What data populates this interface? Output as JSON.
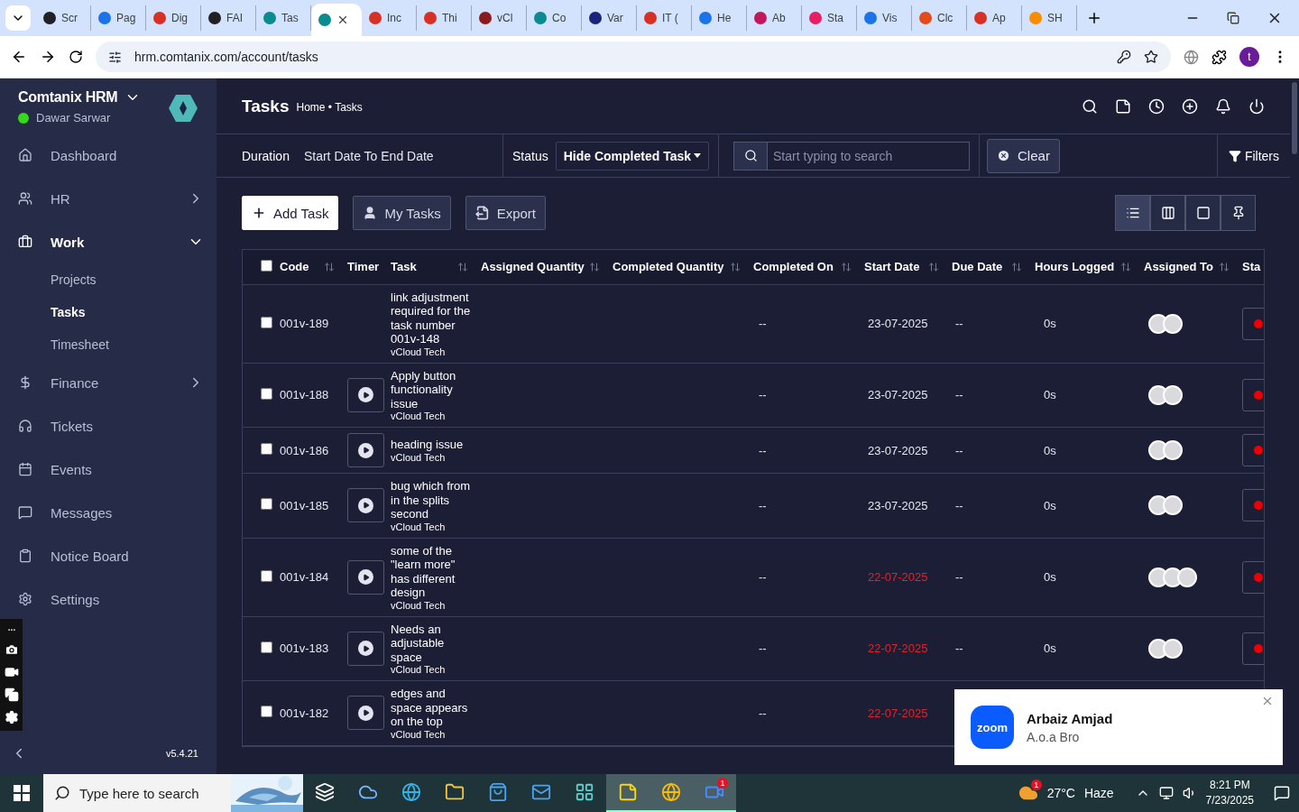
{
  "browser": {
    "tabs": [
      {
        "label": "Scr",
        "selected": false
      },
      {
        "label": "Pag",
        "selected": false
      },
      {
        "label": "Dig",
        "selected": false
      },
      {
        "label": "FAI",
        "selected": false
      },
      {
        "label": "Tas",
        "selected": false
      },
      {
        "selected": true
      },
      {
        "label": "Inc",
        "selected": false
      },
      {
        "label": "Thi",
        "selected": false
      },
      {
        "label": "vCl",
        "selected": false
      },
      {
        "label": "Co",
        "selected": false
      },
      {
        "label": "Var",
        "selected": false
      },
      {
        "label": "IT (",
        "selected": false
      },
      {
        "label": "He",
        "selected": false
      },
      {
        "label": "Ab",
        "selected": false
      },
      {
        "label": "Sta",
        "selected": false
      },
      {
        "label": "Vis",
        "selected": false
      },
      {
        "label": "Clc",
        "selected": false
      },
      {
        "label": "Ap",
        "selected": false
      },
      {
        "label": "SH",
        "selected": false
      }
    ],
    "url": "hrm.comtanix.com/account/tasks",
    "profile_initial": "t"
  },
  "sidebar": {
    "brand": "Comtanix HRM",
    "user": "Dawar Sarwar",
    "online": true,
    "items": [
      {
        "label": "Dashboard",
        "selected": false
      },
      {
        "label": "HR",
        "selected": false,
        "expanded": false
      },
      {
        "label": "Work",
        "selected": true,
        "expanded": true,
        "children": [
          {
            "label": "Projects",
            "selected": false
          },
          {
            "label": "Tasks",
            "selected": true
          },
          {
            "label": "Timesheet",
            "selected": false
          }
        ]
      },
      {
        "label": "Finance",
        "selected": false,
        "expanded": false
      },
      {
        "label": "Tickets",
        "selected": false
      },
      {
        "label": "Events",
        "selected": false
      },
      {
        "label": "Messages",
        "selected": false
      },
      {
        "label": "Notice Board",
        "selected": false
      },
      {
        "label": "Settings",
        "selected": false
      }
    ],
    "version": "v5.4.21"
  },
  "header": {
    "title": "Tasks",
    "breadcrumb": "Home • Tasks"
  },
  "filters": {
    "duration_label": "Duration",
    "duration_value": "Start Date To End Date",
    "status_label": "Status",
    "status_value": "Hide Completed Task",
    "search_placeholder": "Start typing to search",
    "clear": "Clear",
    "filters": "Filters"
  },
  "actions": [
    {
      "label": "Add Task",
      "kind": "primary"
    },
    {
      "label": "My Tasks",
      "kind": "secondary"
    },
    {
      "label": "Export",
      "kind": "secondary"
    }
  ],
  "views": [
    {
      "selected": true
    },
    {
      "selected": false
    },
    {
      "selected": false
    },
    {
      "selected": false
    }
  ],
  "table": {
    "all_checked": false,
    "columns": [
      {
        "label": "Code",
        "sortable": true
      },
      {
        "label": "Timer",
        "sortable": false
      },
      {
        "label": "Task",
        "sortable": true
      },
      {
        "label": "Assigned Quantity",
        "sortable": true
      },
      {
        "label": "Completed Quantity",
        "sortable": true
      },
      {
        "label": "Completed On",
        "sortable": true
      },
      {
        "label": "Start Date",
        "sortable": true
      },
      {
        "label": "Due Date",
        "sortable": true
      },
      {
        "label": "Hours Logged",
        "sortable": true
      },
      {
        "label": "Assigned To",
        "sortable": true
      },
      {
        "label": "Sta",
        "sortable": false
      }
    ],
    "rows": [
      {
        "checked": false,
        "code": "001v-189",
        "timer": false,
        "task": "link adjustment required for the task number 001v-148",
        "project": "vCloud Tech",
        "completed_on": "--",
        "start_date": "23-07-2025",
        "overdue": false,
        "due_date": "--",
        "hours_logged": "0s",
        "assignees": [
          {
            "kind": "user"
          },
          {
            "kind": "user"
          }
        ]
      },
      {
        "checked": false,
        "code": "001v-188",
        "timer": true,
        "task": "Apply button functionality issue",
        "project": "vCloud Tech",
        "completed_on": "--",
        "start_date": "23-07-2025",
        "overdue": false,
        "due_date": "--",
        "hours_logged": "0s",
        "assignees": [
          {
            "kind": "user"
          },
          {
            "kind": "user"
          }
        ]
      },
      {
        "checked": false,
        "code": "001v-186",
        "timer": true,
        "task": "heading issue",
        "project": "vCloud Tech",
        "completed_on": "--",
        "start_date": "23-07-2025",
        "overdue": false,
        "due_date": "--",
        "hours_logged": "0s",
        "assignees": [
          {
            "kind": "user"
          },
          {
            "kind": "user"
          }
        ]
      },
      {
        "checked": false,
        "code": "001v-185",
        "timer": true,
        "task": "bug which from in the splits second",
        "project": "vCloud Tech",
        "completed_on": "--",
        "start_date": "23-07-2025",
        "overdue": false,
        "due_date": "--",
        "hours_logged": "0s",
        "assignees": [
          {
            "kind": "user"
          },
          {
            "kind": "user"
          }
        ]
      },
      {
        "checked": false,
        "code": "001v-184",
        "timer": true,
        "task": "some of the \"learn more\" has different design",
        "project": "vCloud Tech",
        "completed_on": "--",
        "start_date": "22-07-2025",
        "overdue": true,
        "due_date": "--",
        "hours_logged": "0s",
        "assignees": [
          {
            "kind": "user"
          },
          {
            "kind": "user"
          },
          {
            "kind": "user"
          }
        ]
      },
      {
        "checked": false,
        "code": "001v-183",
        "timer": true,
        "task": "Needs an adjustable space",
        "project": "vCloud Tech",
        "completed_on": "--",
        "start_date": "22-07-2025",
        "overdue": true,
        "due_date": "--",
        "hours_logged": "0s",
        "assignees": [
          {
            "kind": "user"
          },
          {
            "kind": "user"
          }
        ]
      },
      {
        "checked": false,
        "code": "001v-182",
        "timer": true,
        "task": "edges and space appears on the top",
        "project": "vCloud Tech",
        "completed_on": "--",
        "start_date": "22-07-2025",
        "overdue": true
      }
    ]
  },
  "notification": {
    "app_logo": "zoom",
    "title": "Arbaiz Amjad",
    "message": "A.o.a Bro"
  },
  "taskbar": {
    "search_placeholder": "Type here to search",
    "apps": [
      {
        "active": false
      },
      {
        "active": false
      },
      {
        "active": false
      },
      {
        "active": false
      },
      {
        "active": false
      },
      {
        "active": false
      },
      {
        "active": false
      },
      {
        "active": true
      },
      {
        "active": true
      },
      {
        "active": true,
        "badge": "1"
      }
    ],
    "weather": {
      "badge": "1",
      "temperature": "27°C",
      "condition": "Haze"
    },
    "time": "8:21 PM",
    "date": "7/23/2025"
  }
}
